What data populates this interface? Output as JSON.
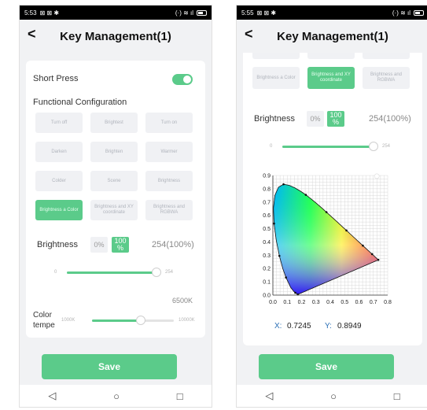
{
  "left": {
    "status": {
      "time": "5:53",
      "signal": "☲ ▽ ▐",
      "network": "☲"
    },
    "header": {
      "title": "Key Management(1)",
      "back_label": "<"
    },
    "short_press": {
      "label": "Short Press",
      "on": true
    },
    "functional": {
      "label": "Functional Configuration"
    },
    "buttons": [
      {
        "label": "Turn off",
        "active": false
      },
      {
        "label": "Brightest",
        "active": false
      },
      {
        "label": "Turn on",
        "active": false
      },
      {
        "label": "Darken",
        "active": false
      },
      {
        "label": "Brighten",
        "active": false
      },
      {
        "label": "Warmer",
        "active": false
      },
      {
        "label": "Colder",
        "active": false
      },
      {
        "label": "Scene",
        "active": false
      },
      {
        "label": "Brightness",
        "active": false
      },
      {
        "label": "Brightness a Color",
        "active": true
      },
      {
        "label": "Brightness and XY coordinate",
        "active": false
      },
      {
        "label": "Brightness and RGBWA",
        "active": false
      }
    ],
    "brightness": {
      "label": "Brightness",
      "opt0": "0%",
      "opt100": "100",
      "opt100_sub": "%",
      "value_text": "254(100%)",
      "slider_min": "0",
      "slider_max": "254",
      "level": 1.0
    },
    "color_temp": {
      "label_line1": "Color",
      "label_line2": "tempe",
      "value_text": "6500K",
      "min": "1000K",
      "max": "10000K",
      "level": 0.6
    },
    "save_label": "Save"
  },
  "right": {
    "status": {
      "time": "5:55",
      "network": "☲"
    },
    "header": {
      "title": "Key Management(1)",
      "back_label": "<"
    },
    "buttons_top": [
      {
        "label": "",
        "active": false
      },
      {
        "label": "",
        "active": false
      },
      {
        "label": "",
        "active": false
      }
    ],
    "buttons_row": [
      {
        "label": "Brightness a Color",
        "active": false
      },
      {
        "label": "Brightness and XY coordinate",
        "active": true
      },
      {
        "label": "Brightness and RGBWA",
        "active": false
      }
    ],
    "brightness": {
      "label": "Brightness",
      "opt0": "0%",
      "opt100": "100",
      "opt100_sub": "%",
      "value_text": "254(100%)",
      "slider_min": "0",
      "slider_max": "254",
      "level": 1.0
    },
    "chart_data": {
      "type": "scatter",
      "title": "",
      "xlabel": "",
      "ylabel": "",
      "xlim": [
        0.0,
        0.8
      ],
      "ylim": [
        0.0,
        0.9
      ],
      "x_ticks": [
        "0.0",
        "0.1",
        "0.2",
        "0.3",
        "0.4",
        "0.5",
        "0.6",
        "0.7",
        "0.8"
      ],
      "y_ticks": [
        "0.0",
        "0.1",
        "0.2",
        "0.3",
        "0.4",
        "0.5",
        "0.6",
        "0.7",
        "0.8",
        "0.9"
      ],
      "grid": true
    },
    "xy": {
      "x_label": "X:",
      "x_value": "0.7245",
      "y_label": "Y:",
      "y_value": "0.8949"
    },
    "save_label": "Save"
  },
  "nav": {
    "back": "◁",
    "home": "○",
    "recent": "□"
  }
}
